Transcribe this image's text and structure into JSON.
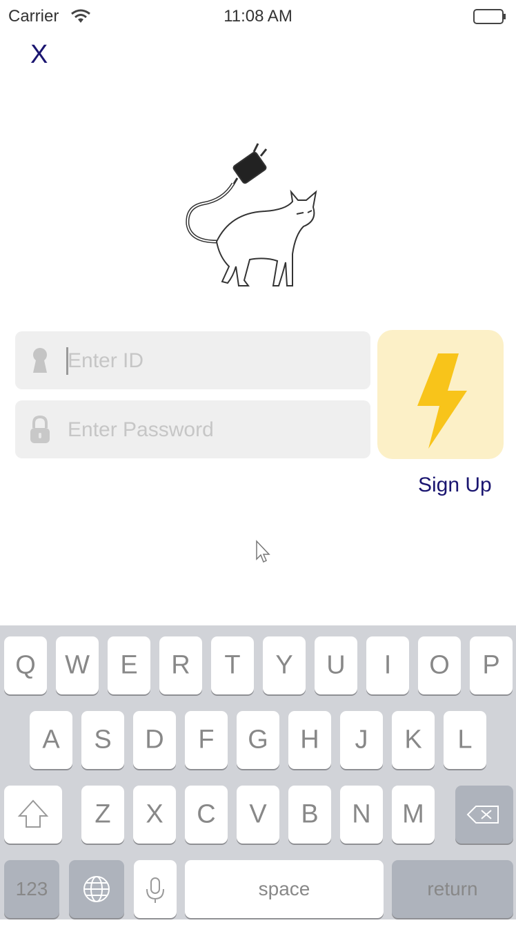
{
  "status_bar": {
    "carrier": "Carrier",
    "time": "11:08 AM"
  },
  "close_button": "X",
  "login": {
    "id_placeholder": "Enter ID",
    "password_placeholder": "Enter Password",
    "signup_label": "Sign Up"
  },
  "colors": {
    "accent": "#1a1570",
    "bolt": "#f8c41a",
    "bolt_bg": "#fcf0c7",
    "field_bg": "#efefef"
  },
  "keyboard": {
    "row1": [
      "Q",
      "W",
      "E",
      "R",
      "T",
      "Y",
      "U",
      "I",
      "O",
      "P"
    ],
    "row2": [
      "A",
      "S",
      "D",
      "F",
      "G",
      "H",
      "J",
      "K",
      "L"
    ],
    "row3": [
      "Z",
      "X",
      "C",
      "V",
      "B",
      "N",
      "M"
    ],
    "numbers": "123",
    "space": "space",
    "return": "return",
    "icons": [
      "shift-icon",
      "backspace-icon",
      "globe-icon",
      "microphone-icon"
    ]
  }
}
